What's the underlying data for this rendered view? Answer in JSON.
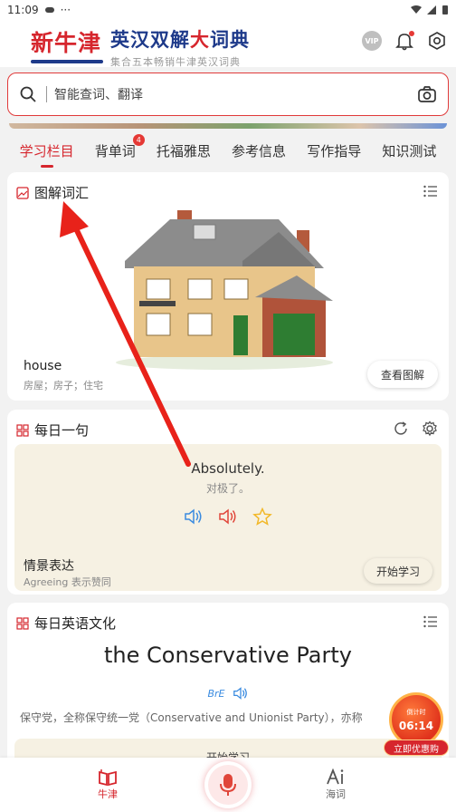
{
  "status_bar": {
    "time": "11:09",
    "dots": "···"
  },
  "header": {
    "logo_main": "新牛津",
    "logo_title_part1": "英汉双解",
    "logo_title_highlight": "大",
    "logo_title_part2": "词典",
    "logo_subtitle": "集合五本畅销牛津英汉词典",
    "vip_label": "VIP"
  },
  "search": {
    "placeholder": "智能查词、翻译"
  },
  "tabs": [
    {
      "label": "学习栏目",
      "active": true
    },
    {
      "label": "背单词",
      "badge": "4"
    },
    {
      "label": "托福雅思"
    },
    {
      "label": "参考信息"
    },
    {
      "label": "写作指导"
    },
    {
      "label": "知识测试"
    }
  ],
  "illustrated": {
    "title": "图解词汇",
    "word": "house",
    "definition": "房屋；房子；住宅",
    "button": "查看图解"
  },
  "daily_sentence": {
    "title": "每日一句",
    "sentence_en": "Absolutely.",
    "sentence_cn": "对极了。",
    "scene_title": "情景表达",
    "scene_sub": "Agreeing 表示赞同",
    "button": "开始学习"
  },
  "culture": {
    "title": "每日英语文化",
    "term": "the Conservative Party",
    "accent": "BrE",
    "definition": "保守党，全称保守统一党（Conservative and Unionist Party），亦称",
    "button": "开始学习"
  },
  "promo": {
    "label": "倒计时",
    "time": "06:14",
    "button": "立即优惠购"
  },
  "bottom_nav": {
    "left_label": "牛津",
    "right_label": "海词"
  },
  "colors": {
    "brand_red": "#d6262d",
    "brand_blue": "#1e3a8a",
    "card_tint": "#f6f1e3"
  }
}
